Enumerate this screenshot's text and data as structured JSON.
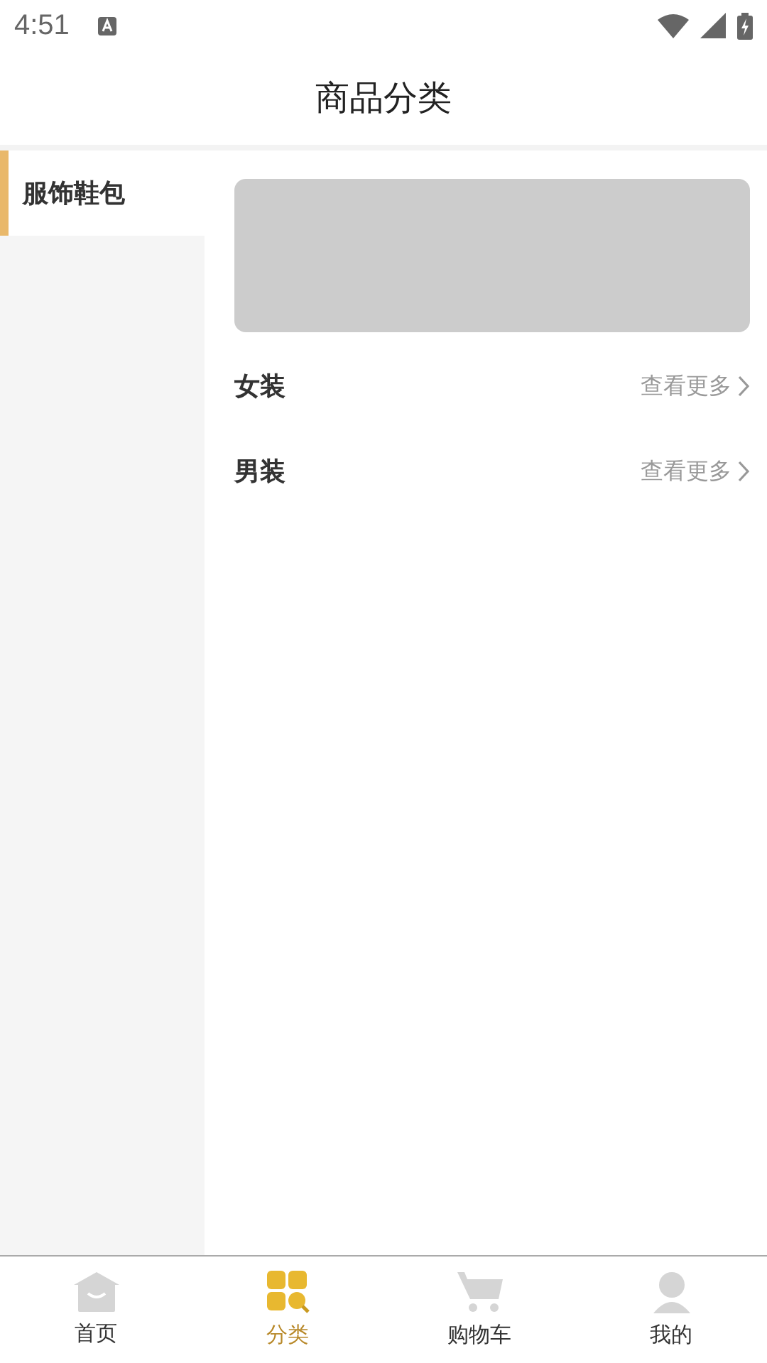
{
  "status_bar": {
    "time": "4:51"
  },
  "header": {
    "title": "商品分类"
  },
  "sidebar": {
    "items": [
      {
        "label": "服饰鞋包",
        "selected": true
      }
    ]
  },
  "content": {
    "banner": {
      "kind": "placeholder"
    },
    "sections": [
      {
        "title": "女装",
        "more": "查看更多"
      },
      {
        "title": "男装",
        "more": "查看更多"
      }
    ]
  },
  "tab_bar": [
    {
      "label": "首页",
      "kind": "home",
      "selected": false
    },
    {
      "label": "分类",
      "kind": "grid",
      "selected": true
    },
    {
      "label": "购物车",
      "kind": "cart",
      "selected": false
    },
    {
      "label": "我的",
      "kind": "user",
      "selected": false
    }
  ]
}
